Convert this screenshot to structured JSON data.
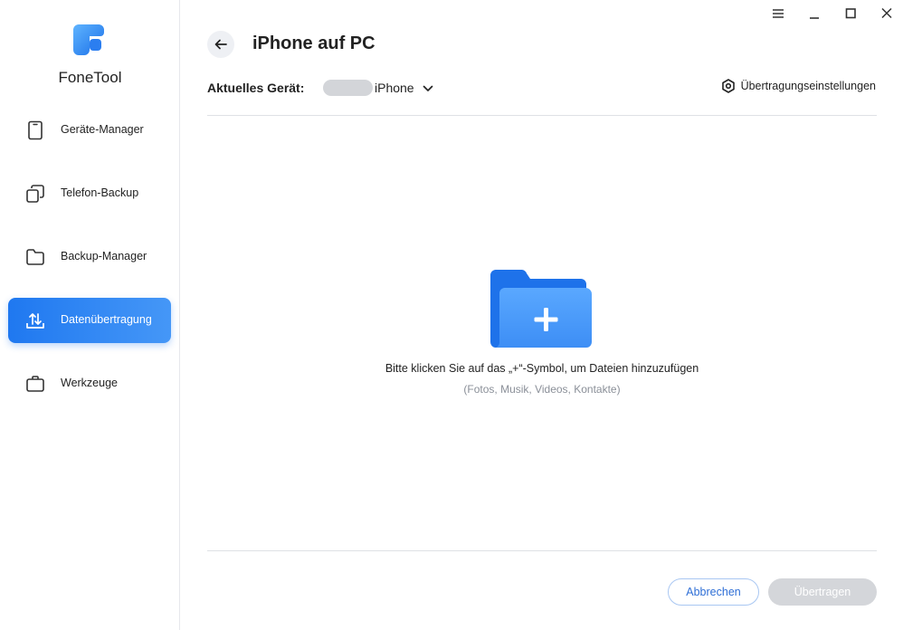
{
  "app": {
    "name": "FoneTool",
    "accent_color": "#1f78f0"
  },
  "sidebar": {
    "items": [
      {
        "label": "Geräte-Manager",
        "icon": "phone-icon",
        "active": false
      },
      {
        "label": "Telefon-Backup",
        "icon": "copy-icon",
        "active": false
      },
      {
        "label": "Backup-Manager",
        "icon": "folder-icon",
        "active": false
      },
      {
        "label": "Datenübertragung",
        "icon": "transfer-icon",
        "active": true
      },
      {
        "label": "Werkzeuge",
        "icon": "briefcase-icon",
        "active": false
      }
    ]
  },
  "window_controls": [
    "menu-icon",
    "minimize-icon",
    "maximize-icon",
    "close-icon"
  ],
  "header": {
    "title": "iPhone auf PC",
    "device_label": "Aktuelles Gerät:",
    "device_name": "iPhone",
    "settings_label": "Übertragungseinstellungen"
  },
  "drop_zone": {
    "hint": "Bitte klicken Sie auf das „+“-Symbol, um Dateien hinzuzufügen",
    "subhint": "(Fotos, Musik, Videos, Kontakte)"
  },
  "footer": {
    "cancel_label": "Abbrechen",
    "transfer_label": "Übertragen",
    "transfer_disabled": true
  }
}
